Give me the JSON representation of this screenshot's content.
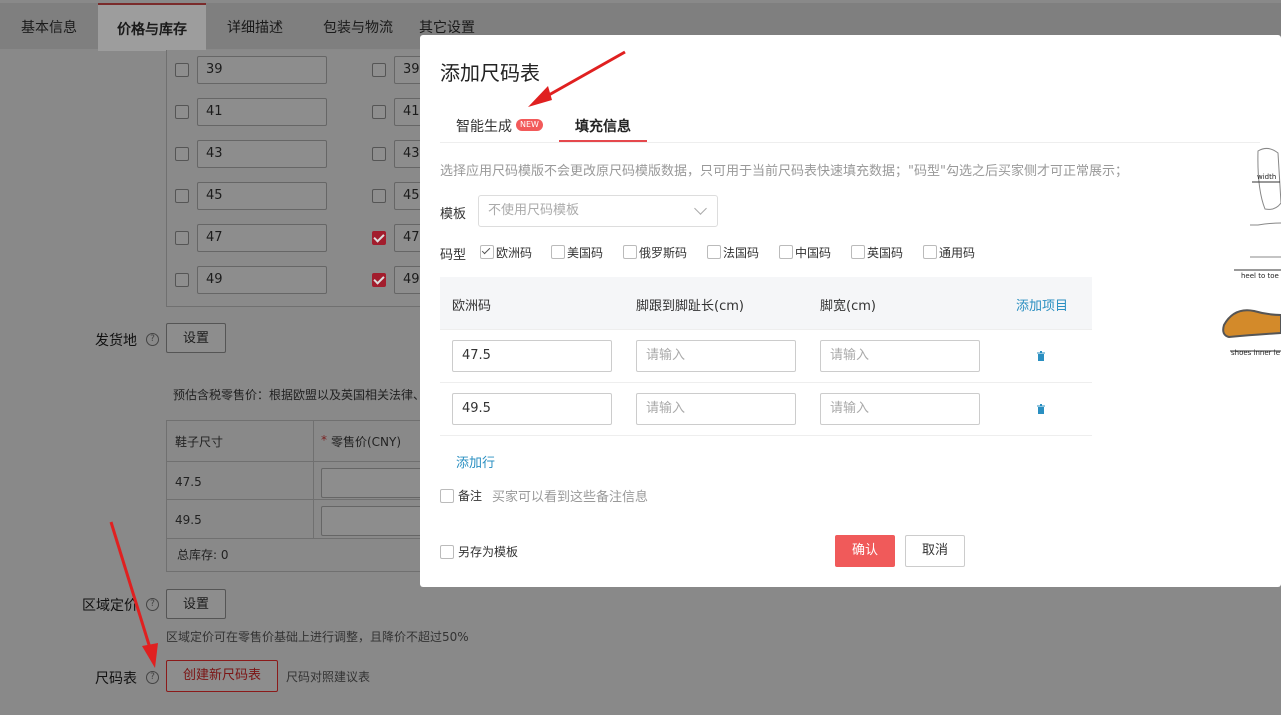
{
  "tabs": [
    "基本信息",
    "价格与库存",
    "详细描述",
    "包装与物流",
    "其它设置"
  ],
  "active_tab": "价格与库存",
  "size_rows": [
    {
      "left": "39",
      "left_checked": false,
      "right": "39.",
      "right_checked": false
    },
    {
      "left": "41",
      "left_checked": false,
      "right": "41.",
      "right_checked": false
    },
    {
      "left": "43",
      "left_checked": false,
      "right": "43.",
      "right_checked": false
    },
    {
      "left": "45",
      "left_checked": false,
      "right": "45.",
      "right_checked": false
    },
    {
      "left": "47",
      "left_checked": false,
      "right": "47.",
      "right_checked": true
    },
    {
      "left": "49",
      "left_checked": false,
      "right": "49.",
      "right_checked": true
    }
  ],
  "ship_from": {
    "label": "发货地",
    "button": "设置"
  },
  "tax_note": "预估含税零售价：根据欧盟以及英国相关法律、",
  "price_table": {
    "col1": "鞋子尺寸",
    "col2": "零售价(CNY)",
    "required_mark": "*",
    "rows": [
      "47.5",
      "49.5"
    ],
    "total": "总库存: 0"
  },
  "region_price": {
    "label": "区域定价",
    "button": "设置",
    "note": "区域定价可在零售价基础上进行调整，且降价不超过50%"
  },
  "size_chart": {
    "label": "尺码表",
    "button": "创建新尺码表",
    "note": "尺码对照建议表"
  },
  "modal": {
    "title": "添加尺码表",
    "tab_smart": "智能生成",
    "badge": "NEW",
    "tab_fill": "填充信息",
    "hint": "选择应用尺码模版不会更改原尺码模版数据，只可用于当前尺码表快速填充数据；\"码型\"勾选之后买家侧才可正常展示；",
    "template_label": "模板",
    "template_placeholder": "不使用尺码模板",
    "size_type_label": "码型",
    "size_types": [
      {
        "label": "欧洲码",
        "checked": true
      },
      {
        "label": "美国码",
        "checked": false
      },
      {
        "label": "俄罗斯码",
        "checked": false
      },
      {
        "label": "法国码",
        "checked": false
      },
      {
        "label": "中国码",
        "checked": false
      },
      {
        "label": "英国码",
        "checked": false
      },
      {
        "label": "通用码",
        "checked": false
      }
    ],
    "table": {
      "headers": [
        "欧洲码",
        "脚跟到脚趾长(cm)",
        "脚宽(cm)"
      ],
      "add_item": "添加项目",
      "rows": [
        {
          "size": "47.5",
          "length_placeholder": "请输入",
          "width_placeholder": "请输入"
        },
        {
          "size": "49.5",
          "length_placeholder": "请输入",
          "width_placeholder": "请输入"
        }
      ],
      "add_row": "添加行"
    },
    "remark_label": "备注",
    "remark_placeholder": "买家可以看到这些备注信息",
    "save_template": "另存为模板",
    "confirm": "确认",
    "cancel": "取消",
    "diagram_labels": [
      "width",
      "heel to toe",
      "shoes inner le"
    ]
  },
  "colors": {
    "accent": "#f05a5a",
    "link": "#2a8fc1",
    "overlay": "#898989"
  }
}
